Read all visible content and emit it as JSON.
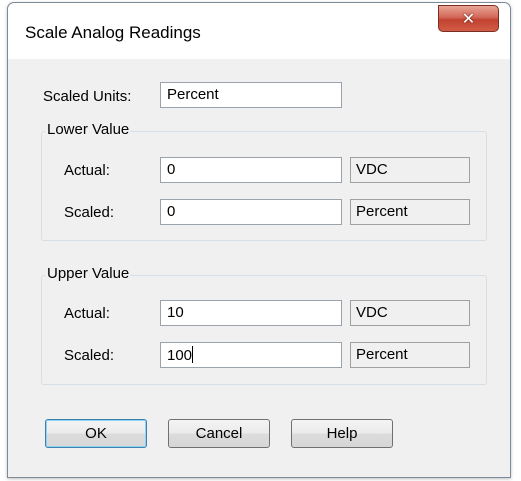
{
  "dialog": {
    "title": "Scale Analog Readings",
    "close_symbol": "✕"
  },
  "scaled_units": {
    "label": "Scaled Units:",
    "value": "Percent"
  },
  "lower_value": {
    "legend": "Lower Value",
    "actual_label": "Actual:",
    "actual_value": "0",
    "actual_unit": "VDC",
    "scaled_label": "Scaled:",
    "scaled_value": "0",
    "scaled_unit": "Percent"
  },
  "upper_value": {
    "legend": "Upper Value",
    "actual_label": "Actual:",
    "actual_value": "10",
    "actual_unit": "VDC",
    "scaled_label": "Scaled:",
    "scaled_value": "100",
    "scaled_unit": "Percent"
  },
  "buttons": {
    "ok": "OK",
    "cancel": "Cancel",
    "help": "Help"
  },
  "colors": {
    "close_button": "#c24231",
    "dialog_background": "#f0f0f0",
    "titlebar": "#ffffff"
  },
  "icons": [
    "close-icon"
  ]
}
